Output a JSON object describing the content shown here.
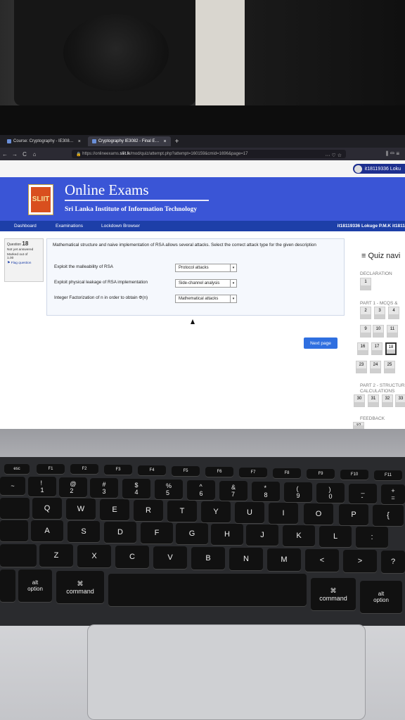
{
  "browser": {
    "tabs": [
      {
        "label": "Course: Cryptography - IE308…",
        "close": "×"
      },
      {
        "label": "Cryptography IE3082 - Final E…",
        "close": "×"
      }
    ],
    "new_tab": "+",
    "url_prefix": "https://onlineexams.",
    "url_domain": "sliit.lk",
    "url_path": "/mod/quiz/attempt.php?attempt=160159&cmid=1696&page=17",
    "url_icons": "··· ♡ ☆",
    "toolbar_icons": "⫼ ▭ ≡",
    "nav": {
      "back": "←",
      "forward": "→",
      "reload": "C",
      "home": "⌂"
    }
  },
  "site": {
    "logo_text": "SLIIT",
    "title": "Online Exams",
    "subtitle": "Sri Lanka Institute of Information Technology",
    "user_pill": "it18119336 Loku",
    "menu": [
      "Dashboard",
      "Examinations",
      "Lockdown Browser"
    ],
    "menu_user": "it18119336 Lokuge P.M.K it1811"
  },
  "question": {
    "label": "Question",
    "number": "18",
    "status": "Not yet answered",
    "marked": "Marked out of",
    "marks": "1.00",
    "flag": "Flag question",
    "text": "Mathematical structure and naive implementation of RSA allows several attacks. Select the correct attack type for the given description",
    "rows": [
      {
        "label": "Exploit the malleability of RSA",
        "selected": "Protocol attacks"
      },
      {
        "label": "Exploit physical leakage of RSA implementation",
        "selected": "Side-channel analysis"
      },
      {
        "label": "Integer Factorization of n in order to obtain Φ(n)",
        "selected": "Mathematical attacks"
      }
    ],
    "next": "Next page"
  },
  "quiz_nav": {
    "title": "Quiz navi",
    "declaration": "DECLARATION",
    "part1": "PART 1 - MCQS &",
    "part2a": "PART 2 - STRUCTUR",
    "part2b": "CALCULATIONS",
    "feedback": "FEEDBACK",
    "cells": [
      "1",
      "2",
      "3",
      "4",
      "9",
      "10",
      "11",
      "16",
      "17",
      "18",
      "23",
      "24",
      "25",
      "30",
      "31",
      "32",
      "33",
      "37"
    ]
  },
  "keyboard": {
    "fn_row": [
      "esc",
      "F1",
      "F2",
      "F3",
      "F4",
      "F5",
      "F6",
      "F7",
      "F8",
      "F9",
      "F10",
      "F11"
    ],
    "num_row": [
      "~",
      "!\n1",
      "@\n2",
      "#\n3",
      "$\n4",
      "%\n5",
      "^\n6",
      "&\n7",
      "*\n8",
      "(\n9",
      ")\n0",
      "_\n-",
      "+\n="
    ],
    "row_q": [
      "Q",
      "W",
      "E",
      "R",
      "T",
      "Y",
      "U",
      "I",
      "O",
      "P",
      "{"
    ],
    "row_a": [
      "A",
      "S",
      "D",
      "F",
      "G",
      "H",
      "J",
      "K",
      "L",
      ":"
    ],
    "row_z": [
      "Z",
      "X",
      "C",
      "V",
      "B",
      "N",
      "M",
      "<",
      ">",
      "?"
    ],
    "bottom": {
      "alt_left": "alt",
      "option_left": "option",
      "cmd_left_sym": "⌘",
      "cmd_left": "command",
      "cmd_right_sym": "⌘",
      "cmd_right": "command",
      "alt_right": "alt",
      "option_right": "option"
    }
  }
}
